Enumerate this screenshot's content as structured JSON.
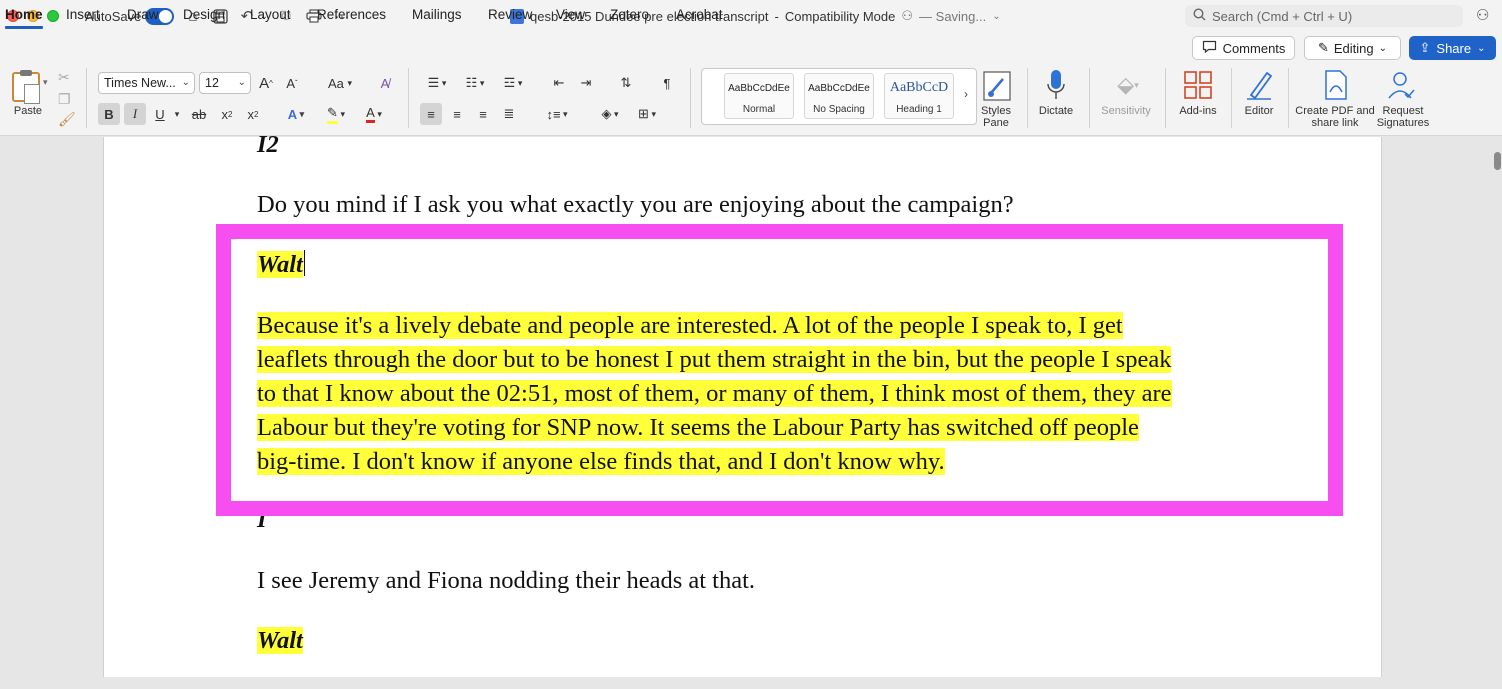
{
  "titlebar": {
    "autosave_label": "AutoSave",
    "document_title": "qesb-2015 Dundee pre election transcript",
    "separator": "-",
    "mode": "Compatibility Mode",
    "status": "— Saving...",
    "search_placeholder": "Search (Cmd + Ctrl + U)"
  },
  "tabs": [
    "Home",
    "Insert",
    "Draw",
    "Design",
    "Layout",
    "References",
    "Mailings",
    "Review",
    "View",
    "Zotero",
    "Acrobat"
  ],
  "actions": {
    "comments": "Comments",
    "editing": "Editing",
    "share": "Share"
  },
  "ribbon": {
    "paste_label": "Paste",
    "font_name": "Times New...",
    "font_size": "12",
    "grow_font": "A",
    "shrink_font": "A",
    "change_case": "Aa",
    "bold": "B",
    "italic": "I",
    "underline": "U",
    "strike": "ab",
    "subscript": "x",
    "superscript": "x",
    "styles": [
      {
        "sample": "AaBbCcDdEe",
        "name": "Normal"
      },
      {
        "sample": "AaBbCcDdEe",
        "name": "No Spacing"
      },
      {
        "sample": "AaBbCcD",
        "name": "Heading 1"
      }
    ],
    "styles_pane": "Styles Pane",
    "dictate": "Dictate",
    "sensitivity": "Sensitivity",
    "addins": "Add-ins",
    "editor": "Editor",
    "create_pdf": "Create PDF and share link",
    "request_signatures": "Request Signatures"
  },
  "document": {
    "speaker_top": "I2",
    "question": "Do you mind if I ask you what exactly you are enjoying about the campaign?",
    "speaker_walt_1": "Walt",
    "answer_lines": [
      "Because it's a lively debate and people are interested. A lot of the people I speak to, I get",
      "leaflets through the door but to be honest I put them straight in the bin, but the people I speak",
      "to that I know about the 02:51, most of them, or many of them, I think most of them, they are",
      "Labour but they're voting for SNP now. It seems the Labour Party has switched off people",
      "big-time. I don't know if anyone else finds that, and I don't know why."
    ],
    "speaker_i": "I",
    "statement": "I see Jeremy and Fiona nodding their heads at that.",
    "speaker_walt_2": "Walt"
  },
  "colors": {
    "highlight": "#ffff3a",
    "frame": "#f74ef1",
    "accent": "#1f63c9"
  }
}
